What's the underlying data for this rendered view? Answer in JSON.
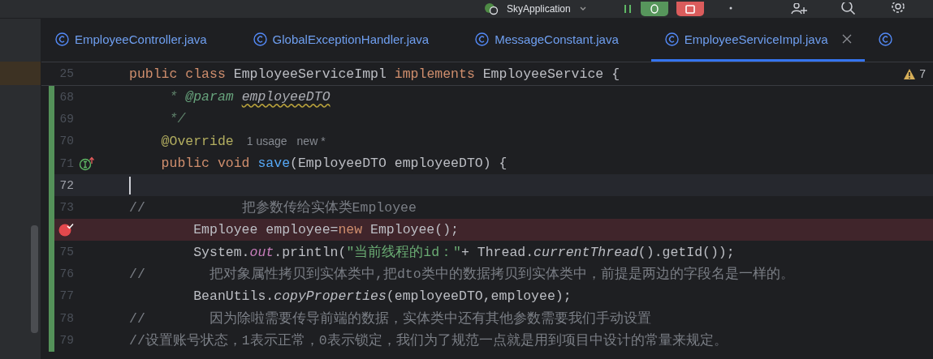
{
  "toolbar": {
    "run_config": "SkyApplication"
  },
  "tabs": [
    {
      "label": "EmployeeController.java",
      "selected": false
    },
    {
      "label": "GlobalExceptionHandler.java",
      "selected": false
    },
    {
      "label": "MessageConstant.java",
      "selected": false
    },
    {
      "label": "EmployeeServiceImpl.java",
      "selected": true
    }
  ],
  "editor": {
    "warnings": "7",
    "sticky_line": {
      "number": "25",
      "segments": [
        {
          "kind": "k",
          "text": "public class "
        },
        {
          "kind": "p",
          "text": "EmployeeServiceImpl "
        },
        {
          "kind": "k",
          "text": "implements "
        },
        {
          "kind": "p",
          "text": "EmployeeService {"
        }
      ]
    },
    "lines": [
      {
        "kind": "plain",
        "number": "68",
        "current": false,
        "breakpoint": false,
        "segments": [
          {
            "kind": "d",
            "text": "     * "
          },
          {
            "kind": "dt",
            "text": "@param "
          },
          {
            "kind": "dp",
            "text": "employeeDTO"
          }
        ]
      },
      {
        "kind": "plain",
        "number": "69",
        "current": false,
        "breakpoint": false,
        "segments": [
          {
            "kind": "d",
            "text": "     */"
          }
        ]
      },
      {
        "kind": "plain",
        "number": "70",
        "current": false,
        "breakpoint": false,
        "segments": [
          {
            "kind": "a",
            "text": "    @Override"
          }
        ],
        "inlay": [
          "1 usage",
          "new *"
        ]
      },
      {
        "kind": "implements",
        "number": "71",
        "current": false,
        "breakpoint": false,
        "segments": [
          {
            "kind": "k",
            "text": "    public void "
          },
          {
            "kind": "m",
            "text": "save"
          },
          {
            "kind": "p",
            "text": "(EmployeeDTO employeeDTO) {"
          }
        ]
      },
      {
        "kind": "plain",
        "number": "72",
        "current": true,
        "breakpoint": false
      },
      {
        "kind": "plain",
        "number": "73",
        "current": false,
        "breakpoint": false,
        "segments": [
          {
            "kind": "c",
            "text": "//            把参数传给实体类Employee"
          }
        ]
      },
      {
        "kind": "plain",
        "current": false,
        "breakpoint": true,
        "segments": [
          {
            "kind": "p",
            "text": "        Employee employee="
          },
          {
            "kind": "k",
            "text": "new "
          },
          {
            "kind": "p",
            "text": "Employee();"
          }
        ]
      },
      {
        "kind": "plain",
        "number": "75",
        "current": false,
        "breakpoint": false,
        "segments": [
          {
            "kind": "p",
            "text": "        System."
          },
          {
            "kind": "f",
            "text": "out"
          },
          {
            "kind": "p",
            "text": ".println("
          },
          {
            "kind": "s",
            "text": "\"当前线程的id：\""
          },
          {
            "kind": "p",
            "text": "+ Thread."
          },
          {
            "kind": "i",
            "text": "currentThread"
          },
          {
            "kind": "p",
            "text": "().getId());"
          }
        ]
      },
      {
        "kind": "plain",
        "number": "76",
        "current": false,
        "breakpoint": false,
        "segments": [
          {
            "kind": "c",
            "text": "//        把对象属性拷贝到实体类中,把dto类中的数据拷贝到实体类中，前提是两边的字段名是一样的。"
          }
        ]
      },
      {
        "kind": "plain",
        "number": "77",
        "current": false,
        "breakpoint": false,
        "segments": [
          {
            "kind": "p",
            "text": "        BeanUtils."
          },
          {
            "kind": "i",
            "text": "copyProperties"
          },
          {
            "kind": "p",
            "text": "(employeeDTO,employee);"
          }
        ]
      },
      {
        "kind": "plain",
        "number": "78",
        "current": false,
        "breakpoint": false,
        "segments": [
          {
            "kind": "c",
            "text": "//        因为除啦需要传导前端的数据，实体类中还有其他参数需要我们手动设置"
          }
        ]
      },
      {
        "kind": "plain",
        "number": "79",
        "current": false,
        "breakpoint": false,
        "segments": [
          {
            "kind": "c",
            "text": "//设置账号状态，1表示正常，0表示锁定，我们为了规范一点就是用到项目中设计的常量来规定。"
          }
        ]
      }
    ]
  }
}
